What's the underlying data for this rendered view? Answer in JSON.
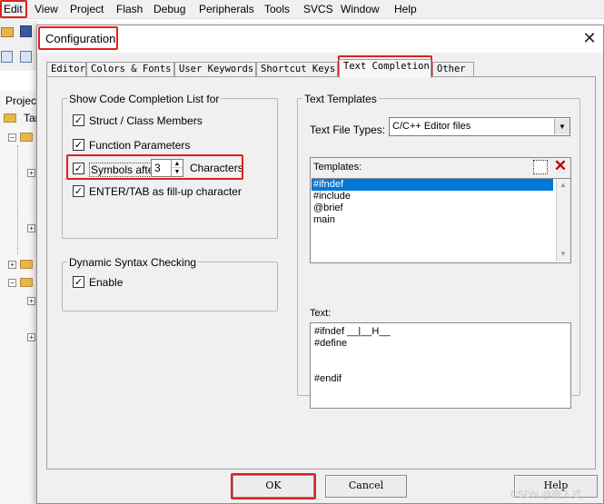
{
  "menubar": {
    "items": [
      "Edit",
      "View",
      "Project",
      "Flash",
      "Debug",
      "Peripherals",
      "Tools",
      "SVCS",
      "Window",
      "Help"
    ]
  },
  "background": {
    "project_label": "Projec",
    "target_label": "Tar"
  },
  "dialog": {
    "title": "Configuration",
    "close_glyph": "✕",
    "tabs": [
      "Editor",
      "Colors & Fonts",
      "User Keywords",
      "Shortcut Keys",
      "Text Completion",
      "Other"
    ],
    "active_tab": "Text Completion"
  },
  "code_completion": {
    "group_title": "Show Code Completion List for",
    "struct_members": {
      "label": "Struct / Class Members",
      "checked": true
    },
    "function_params": {
      "label": "Function Parameters",
      "checked": true
    },
    "symbols_after": {
      "label": "Symbols after",
      "value": "3",
      "suffix": "Characters",
      "checked": true
    },
    "enter_tab": {
      "label": "ENTER/TAB as fill-up character",
      "checked": true
    }
  },
  "syntax_checking": {
    "group_title": "Dynamic Syntax Checking",
    "enable": {
      "label": "Enable",
      "checked": true
    }
  },
  "text_templates": {
    "group_title": "Text Templates",
    "file_types_label": "Text File Types:",
    "file_types_value": "C/C++ Editor files",
    "templates_label": "Templates:",
    "templates": [
      "#ifndef",
      "#include",
      "@brief",
      "main"
    ],
    "selected_template": "#ifndef",
    "text_label": "Text:",
    "text_lines": [
      "#ifndef __|__H__",
      "#define",
      "",
      "",
      "#endif"
    ]
  },
  "buttons": {
    "ok": "OK",
    "cancel": "Cancel",
    "help": "Help"
  },
  "watermark": "CSDN @嵌入式"
}
